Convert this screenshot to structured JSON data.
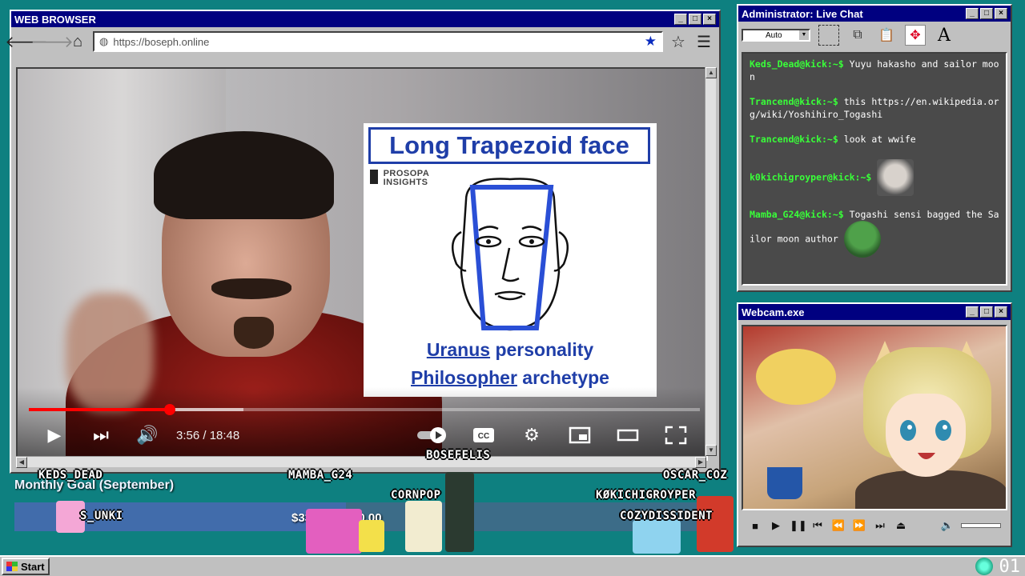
{
  "browser": {
    "title": "WEB BROWSER",
    "url": "https://boseph.online",
    "slide": {
      "title": "Long Trapezoid face",
      "brand_line1": "PROSOPA",
      "brand_line2": "INSIGHTS",
      "line1_a": "Uranus",
      "line1_b": " personality",
      "line2_a": "Philosopher",
      "line2_b": " archetype"
    },
    "player": {
      "timecode": "3:56 / 18:48",
      "progress_played": 0.21,
      "progress_buffered": 0.32
    }
  },
  "chat": {
    "title": "Administrator: Live Chat",
    "font_select": "Auto",
    "messages": [
      {
        "user": "Keds_Dead@kick:~$",
        "text": " Yuyu hakasho and sailor moon",
        "emote": ""
      },
      {
        "user": "Trancend@kick:~$",
        "text": " this https://en.wikipedia.org/wiki/Yoshihiro_Togashi",
        "emote": ""
      },
      {
        "user": "Trancend@kick:~$",
        "text": " look at wwife",
        "emote": ""
      },
      {
        "user": "k0kichigroyper@kick:~$",
        "text": " ",
        "emote": "face"
      },
      {
        "user": "Mamba_G24@kick:~$",
        "text": " Togashi sensi bagged the Sailor moon author ",
        "emote": "pepe"
      }
    ]
  },
  "webcam": {
    "title": "Webcam.exe"
  },
  "overlay": {
    "goal_title": "Monthly Goal (September)",
    "goal_amount": "$33_.00/$700.00",
    "goal_progress": 0.47,
    "names": {
      "keds": "KEDS_DEAD",
      "mamba": "MAMBA_G24",
      "bosefelis": "BOSEFELIS",
      "oscar": "OSCAR_COZ",
      "cornpop": "CORNPOP",
      "kokichi": "KØKICHIGROYPER",
      "sunki": "S_UNKI",
      "cozy": "COZYDISSIDENT"
    }
  },
  "taskbar": {
    "start": "Start",
    "clock": "01"
  }
}
